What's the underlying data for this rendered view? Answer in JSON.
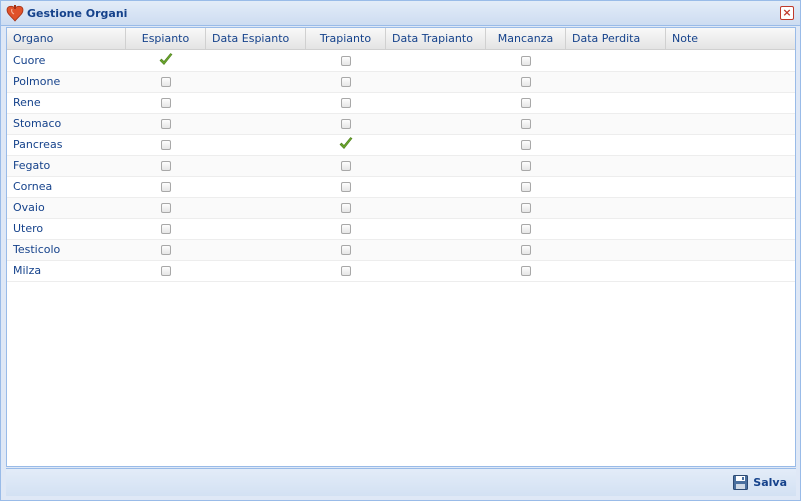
{
  "window": {
    "title": "Gestione Organi",
    "close_label": "×"
  },
  "columns": [
    {
      "key": "organo",
      "label": "Organo"
    },
    {
      "key": "espianto",
      "label": "Espianto"
    },
    {
      "key": "data_espianto",
      "label": "Data Espianto"
    },
    {
      "key": "trapianto",
      "label": "Trapianto"
    },
    {
      "key": "data_trapianto",
      "label": "Data Trapianto"
    },
    {
      "key": "mancanza",
      "label": "Mancanza"
    },
    {
      "key": "data_perdita",
      "label": "Data Perdita"
    },
    {
      "key": "note",
      "label": "Note"
    }
  ],
  "rows": [
    {
      "organo": "Cuore",
      "espianto": true,
      "trapianto": false,
      "mancanza": false
    },
    {
      "organo": "Polmone",
      "espianto": false,
      "trapianto": false,
      "mancanza": false
    },
    {
      "organo": "Rene",
      "espianto": false,
      "trapianto": false,
      "mancanza": false
    },
    {
      "organo": "Stomaco",
      "espianto": false,
      "trapianto": false,
      "mancanza": false
    },
    {
      "organo": "Pancreas",
      "espianto": false,
      "trapianto": true,
      "mancanza": false
    },
    {
      "organo": "Fegato",
      "espianto": false,
      "trapianto": false,
      "mancanza": false
    },
    {
      "organo": "Cornea",
      "espianto": false,
      "trapianto": false,
      "mancanza": false
    },
    {
      "organo": "Ovaio",
      "espianto": false,
      "trapianto": false,
      "mancanza": false
    },
    {
      "organo": "Utero",
      "espianto": false,
      "trapianto": false,
      "mancanza": false
    },
    {
      "organo": "Testicolo",
      "espianto": false,
      "trapianto": false,
      "mancanza": false
    },
    {
      "organo": "Milza",
      "espianto": false,
      "trapianto": false,
      "mancanza": false
    }
  ],
  "footer": {
    "save_label": "Salva"
  },
  "colors": {
    "text": "#15428b",
    "check": "#6aa52c",
    "border": "#99bbe8"
  },
  "icons": {
    "app": "organ-icon",
    "close": "close-icon",
    "check": "check-icon",
    "save": "save-disk-icon"
  }
}
